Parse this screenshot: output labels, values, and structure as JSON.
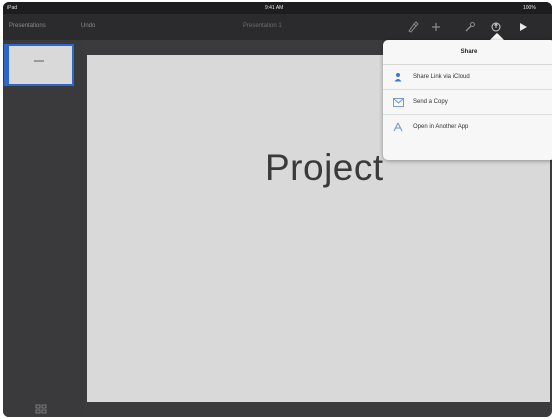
{
  "status_bar": {
    "carrier": "iPad",
    "time": "9:41 AM",
    "battery": "100%"
  },
  "toolbar": {
    "back_label": "Presentations",
    "undo_label": "Undo",
    "document_title": "Presentation 1",
    "icons": [
      "brush-icon",
      "plus-icon",
      "wrench-icon",
      "share-icon",
      "play-icon"
    ]
  },
  "share_popover": {
    "title": "Share",
    "items": [
      {
        "label": "Share Link via iCloud",
        "icon": "person-icon"
      },
      {
        "label": "Send a Copy",
        "icon": "envelope-icon"
      },
      {
        "label": "Open in Another App",
        "icon": "app-icon"
      }
    ]
  },
  "slide": {
    "title": "Project"
  },
  "colors": {
    "accent": "#2c67c9",
    "toolbar_bg": "#2b2b2d",
    "navigator_bg": "#3a3a3c",
    "slide_bg": "#d9d9d9",
    "popover_bg": "#f7f7f7"
  }
}
